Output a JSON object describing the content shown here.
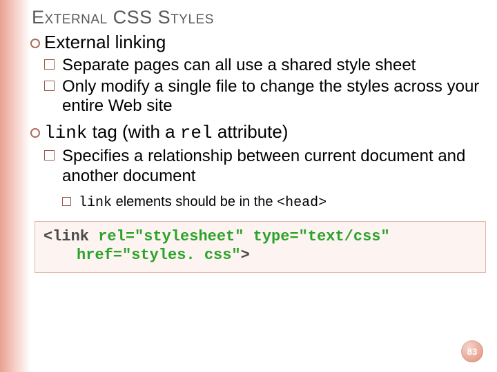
{
  "title": "External CSS Styles",
  "bullets": {
    "b1": "External linking",
    "b1a": "Separate pages can all use a shared style sheet",
    "b1b": "Only modify a single file to change the styles across your entire Web site",
    "b2_code": "link",
    "b2_mid": " tag (with a ",
    "b2_code2": "rel",
    "b2_end": " attribute)",
    "b2a": "Specifies a relationship between current document and another document",
    "b2a1_code": "link",
    "b2a1_mid": " elements should be in the ",
    "b2a1_code2": "<head>"
  },
  "code": {
    "line1_a": "<link ",
    "line1_b": "rel=\"stylesheet\" type=\"text/css\"",
    "line2_a": "href=\"styles. css\"",
    "line2_b": ">"
  },
  "page_number": "83"
}
